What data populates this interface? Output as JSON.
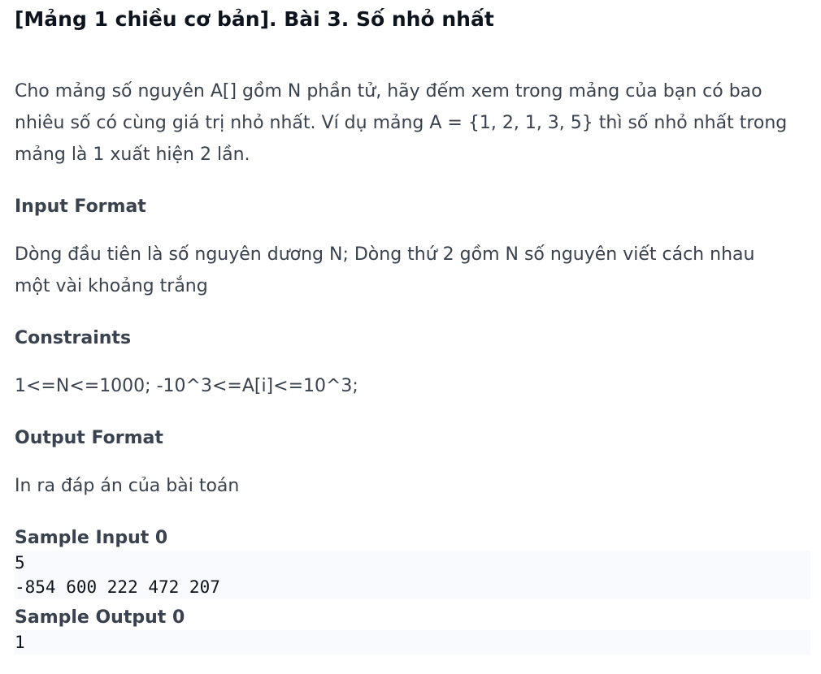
{
  "title": "[Mảng 1 chiều cơ bản]. Bài 3. Số nhỏ nhất",
  "description": "Cho mảng số nguyên A[] gồm N phần tử, hãy đếm xem trong mảng của bạn có bao nhiêu số có cùng giá trị nhỏ nhất. Ví dụ mảng A = {1, 2, 1, 3, 5} thì số nhỏ nhất trong mảng là 1 xuất hiện 2 lần.",
  "input_format": {
    "heading": "Input Format",
    "text": "Dòng đầu tiên là số nguyên dương N; Dòng thứ 2 gồm N số nguyên viết cách nhau một vài khoảng trắng"
  },
  "constraints": {
    "heading": "Constraints",
    "text": "1<=N<=1000; -10^3<=A[i]<=10^3;"
  },
  "output_format": {
    "heading": "Output Format",
    "text": "In ra đáp án của bài toán"
  },
  "sample_input": {
    "heading": "Sample Input 0",
    "lines": [
      "5",
      "-854 600 222 472 207"
    ]
  },
  "sample_output": {
    "heading": "Sample Output 0",
    "lines": [
      "1"
    ]
  }
}
